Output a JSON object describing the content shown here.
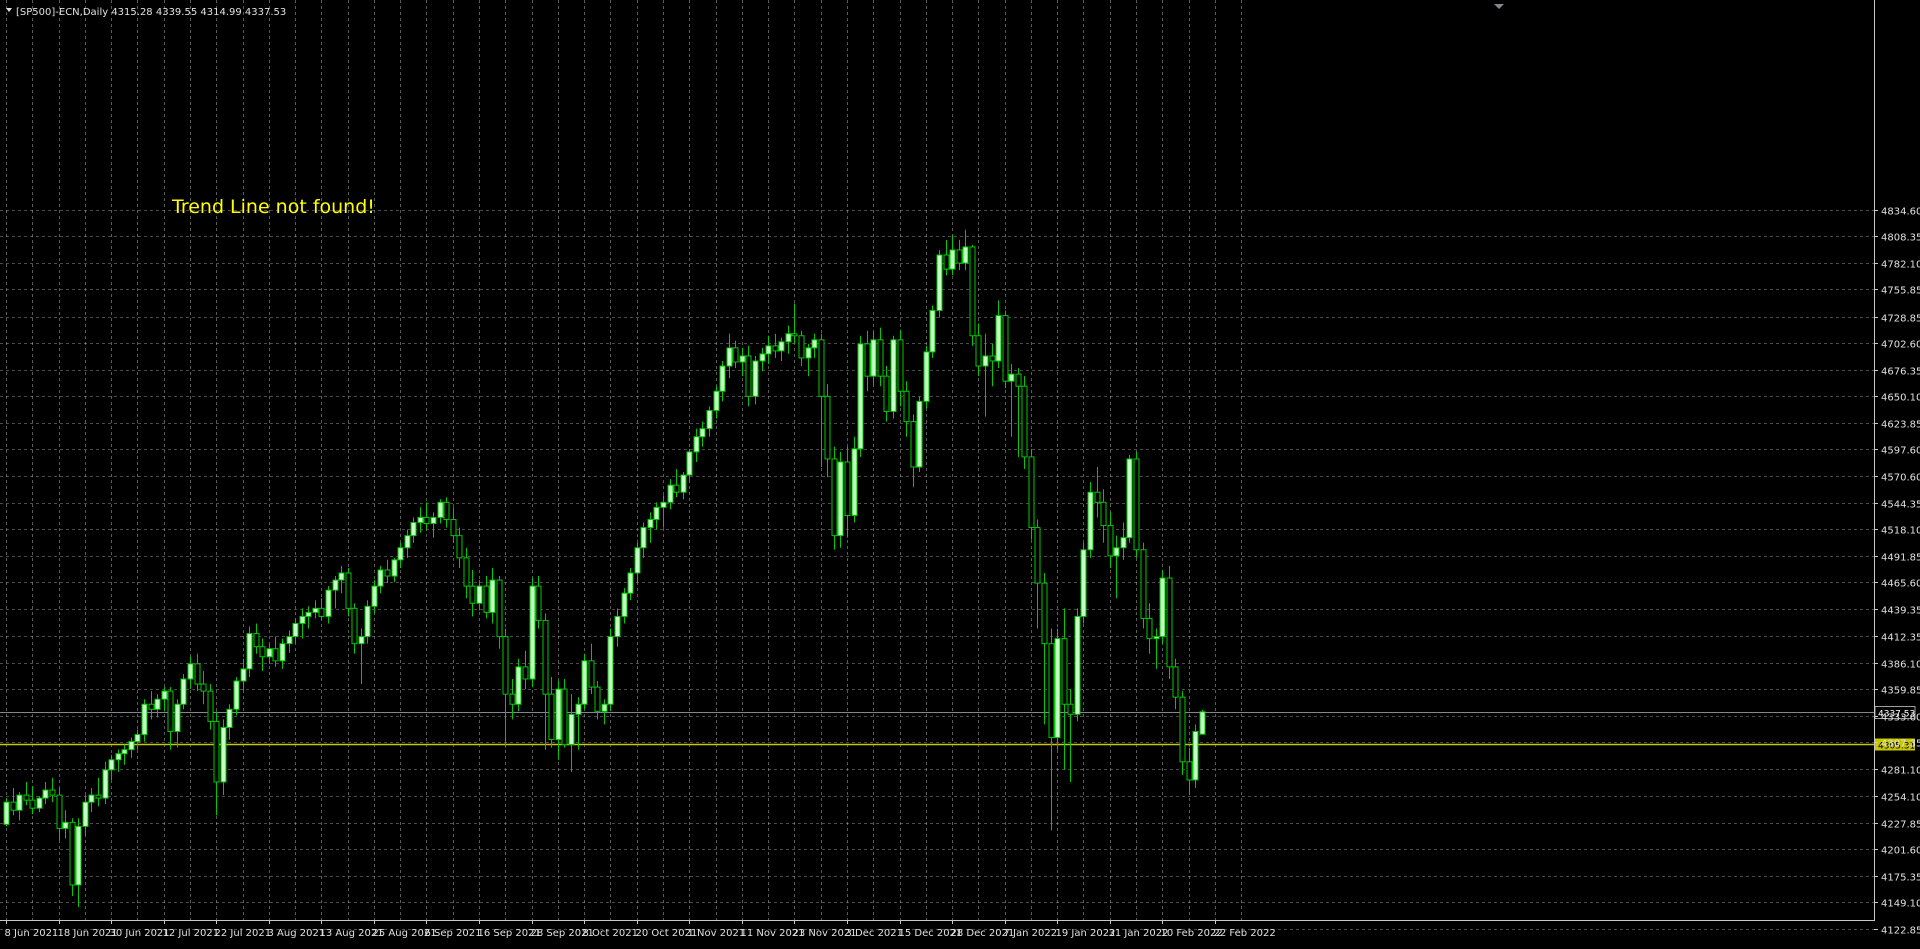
{
  "header": {
    "title": "[SP500]-ECN,Daily  4315.28 4339.55 4314.99 4337.53"
  },
  "message": "Trend Line not found!",
  "colors": {
    "background": "#000000",
    "grid": "#c8c8c8",
    "candle_up": "#c6ffc6",
    "candle_down": "#000000",
    "wick": "#00c800",
    "message": "#ffff00",
    "hline_yellow": "#c8c800",
    "hline_grey": "#808890"
  },
  "chart_data": {
    "type": "candlestick",
    "symbol": "[SP500]-ECN",
    "timeframe": "Daily",
    "ohlc_last": {
      "open": 4315.28,
      "high": 4339.55,
      "low": 4314.99,
      "close": 4337.53
    },
    "ylim": [
      4122.85,
      4850
    ],
    "y_ticks": [
      4834.6,
      4808.35,
      4782.1,
      4755.85,
      4728.85,
      4702.6,
      4676.35,
      4650.1,
      4623.85,
      4597.6,
      4570.6,
      4544.35,
      4518.1,
      4491.85,
      4465.6,
      4439.35,
      4412.35,
      4386.1,
      4359.85,
      4333.6,
      4307.35,
      4281.1,
      4254.1,
      4227.85,
      4201.6,
      4175.35,
      4149.1,
      4122.85
    ],
    "y_tick_labels": [
      "4834.60",
      "4808.35",
      "4782.10",
      "4755.85",
      "4728.85",
      "4702.60",
      "4676.35",
      "4650.10",
      "4623.85",
      "4597.60",
      "4570.60",
      "4544.35",
      "4518.10",
      "4491.85",
      "4465.60",
      "4439.35",
      "4412.35",
      "4386.10",
      "4359.85",
      "4333.60",
      "4307.35",
      "4281.10",
      "4254.10",
      "4227.85",
      "4201.60",
      "4175.35",
      "4149.10",
      "4122.85"
    ],
    "x_tick_labels": [
      "8 Jun 2021",
      "18 Jun 2021",
      "30 Jun 2021",
      "12 Jul 2021",
      "22 Jul 2021",
      "3 Aug 2021",
      "13 Aug 2021",
      "25 Aug 2021",
      "6 Sep 2021",
      "16 Sep 2021",
      "28 Sep 2021",
      "8 Oct 2021",
      "20 Oct 2021",
      "1 Nov 2021",
      "11 Nov 2021",
      "23 Nov 2021",
      "3 Dec 2021",
      "15 Dec 2021",
      "28 Dec 2021",
      "7 Jan 2022",
      "19 Jan 2022",
      "31 Jan 2022",
      "10 Feb 2022",
      "22 Feb 2022"
    ],
    "current_price": {
      "value": 4337.53,
      "label": "4337.53"
    },
    "level_line": {
      "value": 4305.31,
      "label": "4305.31"
    },
    "candles": [
      [
        4226,
        4252,
        4224,
        4248
      ],
      [
        4248,
        4262,
        4235,
        4240
      ],
      [
        4240,
        4258,
        4230,
        4255
      ],
      [
        4255,
        4268,
        4245,
        4250
      ],
      [
        4250,
        4264,
        4236,
        4242
      ],
      [
        4242,
        4254,
        4238,
        4252
      ],
      [
        4252,
        4268,
        4246,
        4260
      ],
      [
        4260,
        4272,
        4248,
        4255
      ],
      [
        4255,
        4262,
        4210,
        4222
      ],
      [
        4222,
        4240,
        4212,
        4228
      ],
      [
        4228,
        4232,
        4155,
        4166
      ],
      [
        4166,
        4232,
        4144,
        4224
      ],
      [
        4224,
        4255,
        4215,
        4248
      ],
      [
        4248,
        4262,
        4238,
        4255
      ],
      [
        4255,
        4272,
        4244,
        4252
      ],
      [
        4252,
        4288,
        4246,
        4280
      ],
      [
        4280,
        4295,
        4270,
        4290
      ],
      [
        4290,
        4300,
        4278,
        4296
      ],
      [
        4296,
        4305,
        4285,
        4300
      ],
      [
        4300,
        4312,
        4292,
        4308
      ],
      [
        4308,
        4320,
        4300,
        4315
      ],
      [
        4315,
        4350,
        4308,
        4345
      ],
      [
        4345,
        4358,
        4330,
        4340
      ],
      [
        4340,
        4355,
        4332,
        4350
      ],
      [
        4350,
        4362,
        4338,
        4358
      ],
      [
        4358,
        4362,
        4300,
        4318
      ],
      [
        4318,
        4350,
        4302,
        4345
      ],
      [
        4345,
        4375,
        4340,
        4370
      ],
      [
        4370,
        4392,
        4360,
        4385
      ],
      [
        4385,
        4395,
        4358,
        4365
      ],
      [
        4365,
        4378,
        4345,
        4358
      ],
      [
        4358,
        4365,
        4320,
        4328
      ],
      [
        4328,
        4338,
        4235,
        4268
      ],
      [
        4268,
        4330,
        4255,
        4322
      ],
      [
        4322,
        4345,
        4310,
        4340
      ],
      [
        4340,
        4372,
        4334,
        4368
      ],
      [
        4368,
        4390,
        4358,
        4380
      ],
      [
        4380,
        4422,
        4372,
        4415
      ],
      [
        4415,
        4425,
        4395,
        4402
      ],
      [
        4402,
        4410,
        4378,
        4392
      ],
      [
        4392,
        4405,
        4385,
        4400
      ],
      [
        4400,
        4412,
        4382,
        4388
      ],
      [
        4388,
        4410,
        4380,
        4405
      ],
      [
        4405,
        4418,
        4396,
        4412
      ],
      [
        4412,
        4430,
        4405,
        4425
      ],
      [
        4425,
        4440,
        4410,
        4432
      ],
      [
        4432,
        4442,
        4420,
        4436
      ],
      [
        4436,
        4448,
        4430,
        4440
      ],
      [
        4440,
        4450,
        4428,
        4432
      ],
      [
        4432,
        4462,
        4425,
        4458
      ],
      [
        4458,
        4472,
        4440,
        4468
      ],
      [
        4468,
        4482,
        4455,
        4475
      ],
      [
        4475,
        4480,
        4432,
        4440
      ],
      [
        4440,
        4445,
        4395,
        4405
      ],
      [
        4405,
        4420,
        4365,
        4412
      ],
      [
        4412,
        4448,
        4405,
        4442
      ],
      [
        4442,
        4468,
        4435,
        4462
      ],
      [
        4462,
        4482,
        4455,
        4478
      ],
      [
        4478,
        4488,
        4465,
        4472
      ],
      [
        4472,
        4490,
        4466,
        4488
      ],
      [
        4488,
        4505,
        4480,
        4500
      ],
      [
        4500,
        4518,
        4490,
        4512
      ],
      [
        4512,
        4530,
        4505,
        4525
      ],
      [
        4525,
        4540,
        4515,
        4530
      ],
      [
        4530,
        4545,
        4518,
        4524
      ],
      [
        4524,
        4535,
        4510,
        4530
      ],
      [
        4530,
        4548,
        4524,
        4545
      ],
      [
        4545,
        4550,
        4520,
        4528
      ],
      [
        4528,
        4540,
        4505,
        4512
      ],
      [
        4512,
        4520,
        4480,
        4490
      ],
      [
        4490,
        4500,
        4450,
        4462
      ],
      [
        4462,
        4478,
        4432,
        4445
      ],
      [
        4445,
        4468,
        4438,
        4462
      ],
      [
        4462,
        4472,
        4430,
        4436
      ],
      [
        4436,
        4480,
        4425,
        4468
      ],
      [
        4468,
        4472,
        4400,
        4412
      ],
      [
        4412,
        4420,
        4302,
        4355
      ],
      [
        4355,
        4370,
        4330,
        4345
      ],
      [
        4345,
        4390,
        4338,
        4382
      ],
      [
        4382,
        4398,
        4360,
        4370
      ],
      [
        4370,
        4470,
        4362,
        4462
      ],
      [
        4462,
        4472,
        4420,
        4428
      ],
      [
        4428,
        4435,
        4300,
        4355
      ],
      [
        4355,
        4372,
        4302,
        4310
      ],
      [
        4310,
        4368,
        4290,
        4360
      ],
      [
        4360,
        4370,
        4302,
        4305
      ],
      [
        4305,
        4355,
        4278,
        4335
      ],
      [
        4335,
        4352,
        4300,
        4345
      ],
      [
        4345,
        4395,
        4340,
        4388
      ],
      [
        4388,
        4405,
        4355,
        4362
      ],
      [
        4362,
        4368,
        4330,
        4338
      ],
      [
        4338,
        4350,
        4325,
        4345
      ],
      [
        4345,
        4420,
        4338,
        4412
      ],
      [
        4412,
        4440,
        4402,
        4432
      ],
      [
        4432,
        4460,
        4425,
        4455
      ],
      [
        4455,
        4480,
        4448,
        4475
      ],
      [
        4475,
        4505,
        4465,
        4500
      ],
      [
        4500,
        4525,
        4490,
        4520
      ],
      [
        4520,
        4535,
        4505,
        4528
      ],
      [
        4528,
        4545,
        4518,
        4540
      ],
      [
        4540,
        4552,
        4520,
        4545
      ],
      [
        4545,
        4568,
        4538,
        4562
      ],
      [
        4562,
        4578,
        4550,
        4555
      ],
      [
        4555,
        4575,
        4548,
        4572
      ],
      [
        4572,
        4598,
        4565,
        4595
      ],
      [
        4595,
        4618,
        4585,
        4610
      ],
      [
        4610,
        4625,
        4600,
        4618
      ],
      [
        4618,
        4640,
        4610,
        4636
      ],
      [
        4636,
        4660,
        4628,
        4655
      ],
      [
        4655,
        4685,
        4645,
        4680
      ],
      [
        4680,
        4712,
        4668,
        4698
      ],
      [
        4698,
        4705,
        4678,
        4684
      ],
      [
        4684,
        4698,
        4670,
        4690
      ],
      [
        4690,
        4700,
        4640,
        4650
      ],
      [
        4650,
        4690,
        4642,
        4685
      ],
      [
        4685,
        4698,
        4675,
        4692
      ],
      [
        4692,
        4710,
        4682,
        4700
      ],
      [
        4700,
        4712,
        4688,
        4695
      ],
      [
        4695,
        4708,
        4685,
        4704
      ],
      [
        4704,
        4720,
        4692,
        4712
      ],
      [
        4712,
        4742,
        4702,
        4710
      ],
      [
        4710,
        4715,
        4680,
        4688
      ],
      [
        4688,
        4702,
        4670,
        4698
      ],
      [
        4698,
        4712,
        4688,
        4706
      ],
      [
        4706,
        4712,
        4580,
        4650
      ],
      [
        4650,
        4662,
        4570,
        4588
      ],
      [
        4588,
        4600,
        4498,
        4512
      ],
      [
        4512,
        4595,
        4500,
        4585
      ],
      [
        4585,
        4600,
        4510,
        4532
      ],
      [
        4532,
        4610,
        4525,
        4598
      ],
      [
        4598,
        4710,
        4590,
        4702
      ],
      [
        4702,
        4715,
        4655,
        4670
      ],
      [
        4670,
        4715,
        4660,
        4706
      ],
      [
        4706,
        4718,
        4660,
        4670
      ],
      [
        4670,
        4680,
        4625,
        4635
      ],
      [
        4635,
        4710,
        4628,
        4706
      ],
      [
        4706,
        4716,
        4640,
        4655
      ],
      [
        4655,
        4665,
        4610,
        4625
      ],
      [
        4625,
        4632,
        4560,
        4580
      ],
      [
        4580,
        4650,
        4575,
        4645
      ],
      [
        4645,
        4700,
        4638,
        4694
      ],
      [
        4694,
        4740,
        4688,
        4735
      ],
      [
        4735,
        4795,
        4728,
        4790
      ],
      [
        4790,
        4805,
        4770,
        4776
      ],
      [
        4776,
        4810,
        4770,
        4795
      ],
      [
        4795,
        4805,
        4775,
        4782
      ],
      [
        4782,
        4815,
        4775,
        4798
      ],
      [
        4798,
        4800,
        4700,
        4710
      ],
      [
        4710,
        4722,
        4670,
        4680
      ],
      [
        4680,
        4712,
        4630,
        4690
      ],
      [
        4690,
        4702,
        4660,
        4685
      ],
      [
        4685,
        4745,
        4678,
        4730
      ],
      [
        4730,
        4735,
        4658,
        4665
      ],
      [
        4665,
        4682,
        4610,
        4672
      ],
      [
        4672,
        4678,
        4590,
        4660
      ],
      [
        4660,
        4670,
        4578,
        4590
      ],
      [
        4590,
        4598,
        4508,
        4520
      ],
      [
        4520,
        4528,
        4420,
        4465
      ],
      [
        4465,
        4475,
        4325,
        4405
      ],
      [
        4405,
        4420,
        4220,
        4312
      ],
      [
        4312,
        4420,
        4300,
        4410
      ],
      [
        4410,
        4440,
        4280,
        4345
      ],
      [
        4345,
        4360,
        4268,
        4335
      ],
      [
        4335,
        4440,
        4328,
        4432
      ],
      [
        4432,
        4505,
        4425,
        4498
      ],
      [
        4498,
        4565,
        4490,
        4555
      ],
      [
        4555,
        4580,
        4530,
        4545
      ],
      [
        4545,
        4558,
        4505,
        4522
      ],
      [
        4522,
        4535,
        4480,
        4492
      ],
      [
        4492,
        4512,
        4450,
        4500
      ],
      [
        4500,
        4525,
        4488,
        4510
      ],
      [
        4510,
        4592,
        4505,
        4588
      ],
      [
        4588,
        4595,
        4490,
        4498
      ],
      [
        4498,
        4505,
        4420,
        4430
      ],
      [
        4430,
        4445,
        4395,
        4410
      ],
      [
        4410,
        4420,
        4380,
        4412
      ],
      [
        4412,
        4478,
        4405,
        4470
      ],
      [
        4470,
        4482,
        4370,
        4382
      ],
      [
        4382,
        4390,
        4340,
        4352
      ],
      [
        4352,
        4358,
        4275,
        4288
      ],
      [
        4288,
        4302,
        4255,
        4270
      ],
      [
        4270,
        4325,
        4262,
        4318
      ],
      [
        4315.28,
        4339.55,
        4314.99,
        4337.53
      ]
    ]
  }
}
